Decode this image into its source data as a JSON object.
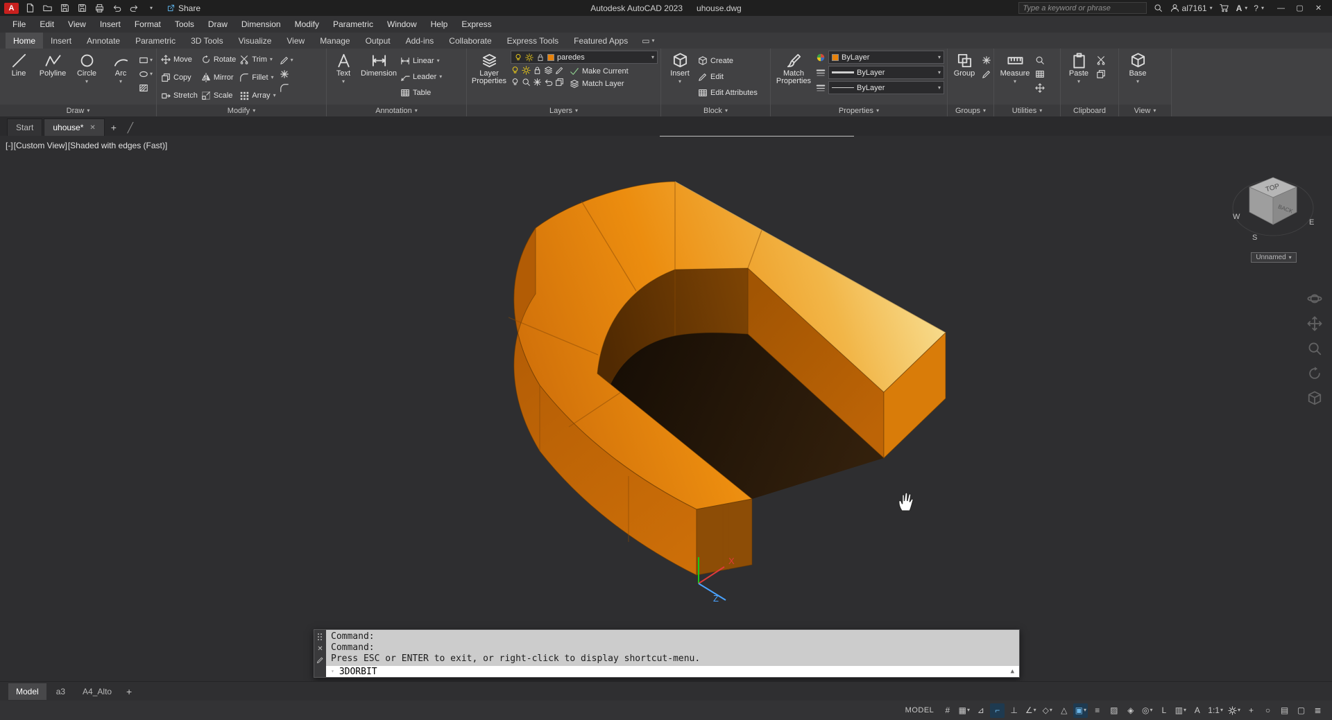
{
  "titlebar": {
    "app_title": "Autodesk AutoCAD 2023",
    "doc_title": "uhouse.dwg",
    "share": "Share",
    "search_placeholder": "Type a keyword or phrase",
    "user": "al7161",
    "help": "?"
  },
  "menubar": {
    "items": [
      "File",
      "Edit",
      "View",
      "Insert",
      "Format",
      "Tools",
      "Draw",
      "Dimension",
      "Modify",
      "Parametric",
      "Window",
      "Help",
      "Express"
    ]
  },
  "ribbon": {
    "tabs": [
      "Home",
      "Insert",
      "Annotate",
      "Parametric",
      "3D Tools",
      "Visualize",
      "View",
      "Manage",
      "Output",
      "Add-ins",
      "Collaborate",
      "Express Tools",
      "Featured Apps"
    ]
  },
  "draw": {
    "label": "Draw",
    "line": "Line",
    "polyline": "Polyline",
    "circle": "Circle",
    "arc": "Arc"
  },
  "modify": {
    "label": "Modify",
    "move": "Move",
    "copy": "Copy",
    "stretch": "Stretch",
    "rotate": "Rotate",
    "mirror": "Mirror",
    "scale": "Scale",
    "trim": "Trim",
    "fillet": "Fillet",
    "array": "Array"
  },
  "annotation": {
    "label": "Annotation",
    "text": "Text",
    "dimension": "Dimension",
    "linear": "Linear",
    "leader": "Leader",
    "table": "Table"
  },
  "layers": {
    "label": "Layers",
    "current": "paredes",
    "properties": "Layer Properties",
    "make_current": "Make Current",
    "match_layer": "Match Layer"
  },
  "block": {
    "label": "Block",
    "insert": "Insert",
    "create": "Create",
    "edit": "Edit",
    "edit_attributes": "Edit Attributes"
  },
  "properties": {
    "label": "Properties",
    "match": "Match Properties",
    "color": "ByLayer",
    "lineweight": "ByLayer",
    "linetype": "ByLayer"
  },
  "groups": {
    "label": "Groups",
    "group": "Group"
  },
  "utilities": {
    "label": "Utilities",
    "measure": "Measure"
  },
  "clipboard": {
    "label": "Clipboard",
    "paste": "Paste"
  },
  "view_panel": {
    "label": "View",
    "base": "Base"
  },
  "doc_tabs": {
    "start": "Start",
    "drawing": "uhouse*"
  },
  "viewport": {
    "min": "[-]",
    "view": "[Custom View]",
    "style": "[Shaded with edges (Fast)]"
  },
  "viewcube": {
    "top": "TOP",
    "side": "BACK",
    "w": "W",
    "s": "S",
    "e": "E",
    "label": "Unnamed"
  },
  "ucs": {
    "x": "X",
    "z": "Z"
  },
  "command": {
    "line1": "Command:",
    "line2": "Command:",
    "line3": "Press ESC or ENTER to exit, or right-click to display shortcut-menu.",
    "active": "3DORBIT"
  },
  "layout": {
    "model": "Model",
    "a3": "a3",
    "a4": "A4_Alto"
  },
  "statusbar": {
    "model": "MODEL",
    "scale": "1:1",
    "icons": [
      {
        "name": "grid-display",
        "glyph": "#"
      },
      {
        "name": "snap-mode",
        "glyph": "▦"
      },
      {
        "name": "infer-constraints",
        "glyph": "⊿"
      },
      {
        "name": "dynamic-input",
        "glyph": "⌐"
      },
      {
        "name": "ortho-mode",
        "glyph": "⊥"
      },
      {
        "name": "polar-tracking",
        "glyph": "∠"
      },
      {
        "name": "isodraft",
        "glyph": "◇"
      },
      {
        "name": "object-snap-tracking",
        "glyph": "△"
      },
      {
        "name": "object-snap",
        "glyph": "▣"
      },
      {
        "name": "lineweight-display",
        "glyph": "≡"
      },
      {
        "name": "transparency",
        "glyph": "▨"
      },
      {
        "name": "selection-cycling",
        "glyph": "◈"
      },
      {
        "name": "3d-object-snap",
        "glyph": "◎"
      },
      {
        "name": "dynamic-ucs",
        "glyph": "L"
      },
      {
        "name": "selection-filter",
        "glyph": "▥"
      },
      {
        "name": "annotation-visibility",
        "glyph": "A"
      },
      {
        "name": "annotation-monitor",
        "glyph": "+"
      },
      {
        "name": "isolate-objects",
        "glyph": "○"
      },
      {
        "name": "hardware-acceleration",
        "glyph": "▤"
      },
      {
        "name": "clean-screen",
        "glyph": "▢"
      },
      {
        "name": "customization",
        "glyph": "≣"
      }
    ]
  },
  "colors": {
    "accent_orange": "#E8820B",
    "top_light": "#F8E7A6",
    "wall": "#C66C07",
    "inner_dark": "#6B3A03",
    "canvas_bg": "#2E2E30"
  }
}
